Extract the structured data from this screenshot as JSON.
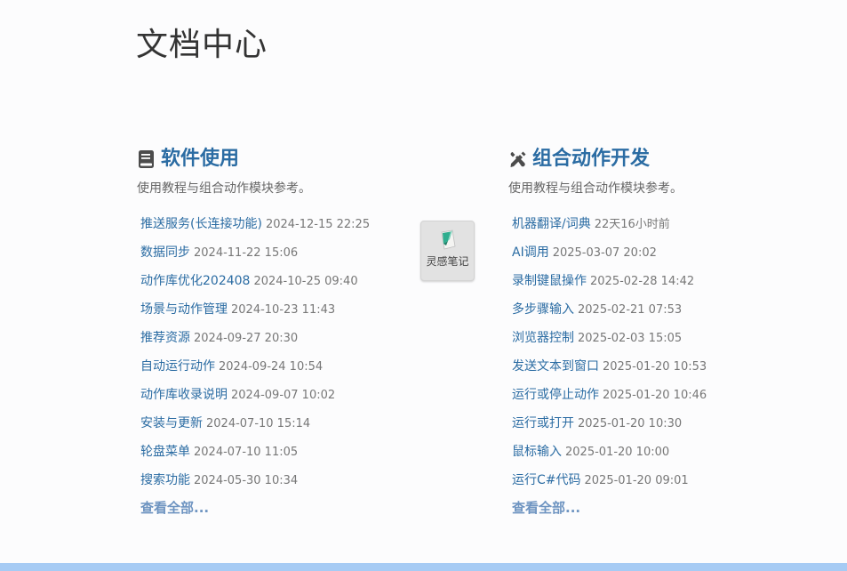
{
  "page": {
    "title": "文档中心"
  },
  "sections": [
    {
      "title": "软件使用",
      "icon": "book-icon",
      "description": "使用教程与组合动作模块参考。",
      "items": [
        {
          "label": "推送服务(长连接功能)",
          "date": "2024-12-15 22:25"
        },
        {
          "label": "数据同步",
          "date": "2024-11-22 15:06"
        },
        {
          "label": "动作库优化202408",
          "date": "2024-10-25 09:40"
        },
        {
          "label": "场景与动作管理",
          "date": "2024-10-23 11:43"
        },
        {
          "label": "推荐资源",
          "date": "2024-09-27 20:30"
        },
        {
          "label": "自动运行动作",
          "date": "2024-09-24 10:54"
        },
        {
          "label": "动作库收录说明",
          "date": "2024-09-07 10:02"
        },
        {
          "label": "安装与更新",
          "date": "2024-07-10 15:14"
        },
        {
          "label": "轮盘菜单",
          "date": "2024-07-10 11:05"
        },
        {
          "label": "搜索功能",
          "date": "2024-05-30 10:34"
        }
      ],
      "view_all": "查看全部..."
    },
    {
      "title": "组合动作开发",
      "icon": "tools-icon",
      "description": "使用教程与组合动作模块参考。",
      "items": [
        {
          "label": "机器翻译/词典",
          "date": "22天16小时前"
        },
        {
          "label": "AI调用",
          "date": "2025-03-07 20:02"
        },
        {
          "label": "录制键鼠操作",
          "date": "2025-02-28 14:42"
        },
        {
          "label": "多步骤输入",
          "date": "2025-02-21 07:53"
        },
        {
          "label": "浏览器控制",
          "date": "2025-02-03 15:05"
        },
        {
          "label": "发送文本到窗口",
          "date": "2025-01-20 10:53"
        },
        {
          "label": "运行或停止动作",
          "date": "2025-01-20 10:46"
        },
        {
          "label": "运行或打开",
          "date": "2025-01-20 10:30"
        },
        {
          "label": "鼠标输入",
          "date": "2025-01-20 10:00"
        },
        {
          "label": "运行C#代码",
          "date": "2025-01-20 09:01"
        }
      ],
      "view_all": "查看全部..."
    }
  ],
  "widget": {
    "label": "灵感笔记",
    "icon": "note-icon"
  },
  "colors": {
    "accent": "#2b6ca3",
    "view_all": "#6e94c1",
    "bottom_bar": "#a6cbf4"
  }
}
